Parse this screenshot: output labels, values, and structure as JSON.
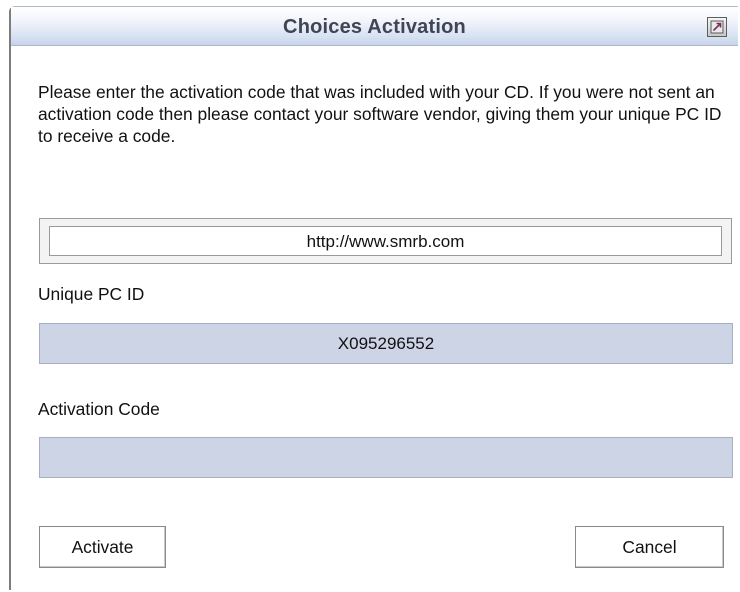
{
  "window": {
    "title": "Choices Activation",
    "close_icon": "close-icon"
  },
  "instructions": "Please enter the activation code that was included with your CD. If you were not sent an activation code then please contact your software vendor, giving them your unique PC ID to receive a code.",
  "website": "http://www.smrb.com",
  "pc_id": {
    "label": "Unique PC ID",
    "value": "X095296552"
  },
  "activation": {
    "label": "Activation Code",
    "value": ""
  },
  "buttons": {
    "activate": "Activate",
    "cancel": "Cancel"
  },
  "colors": {
    "field_background": "#ccd4e6",
    "titlebar_gradient_end": "#c6d4ea",
    "title_text": "#3f4553"
  }
}
